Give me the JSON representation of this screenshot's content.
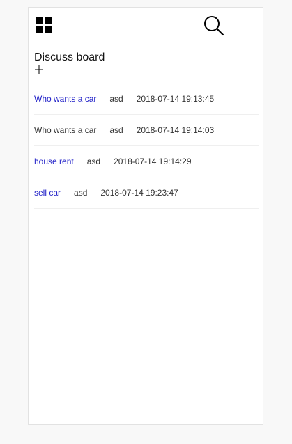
{
  "board": {
    "title": "Discuss board"
  },
  "icons": {
    "menu": "grid-icon",
    "search": "search-icon",
    "add": "plus-icon"
  },
  "colors": {
    "link": "#2323c8",
    "text": "#333333"
  },
  "posts": [
    {
      "topic": "Who wants a car",
      "author": "asd",
      "date": "2018-07-14 19:13:45",
      "linked": true
    },
    {
      "topic": "Who wants a car",
      "author": "asd",
      "date": "2018-07-14 19:14:03",
      "linked": false
    },
    {
      "topic": "house rent",
      "author": "asd",
      "date": "2018-07-14 19:14:29",
      "linked": true
    },
    {
      "topic": "sell car",
      "author": "asd",
      "date": "2018-07-14 19:23:47",
      "linked": true
    }
  ]
}
